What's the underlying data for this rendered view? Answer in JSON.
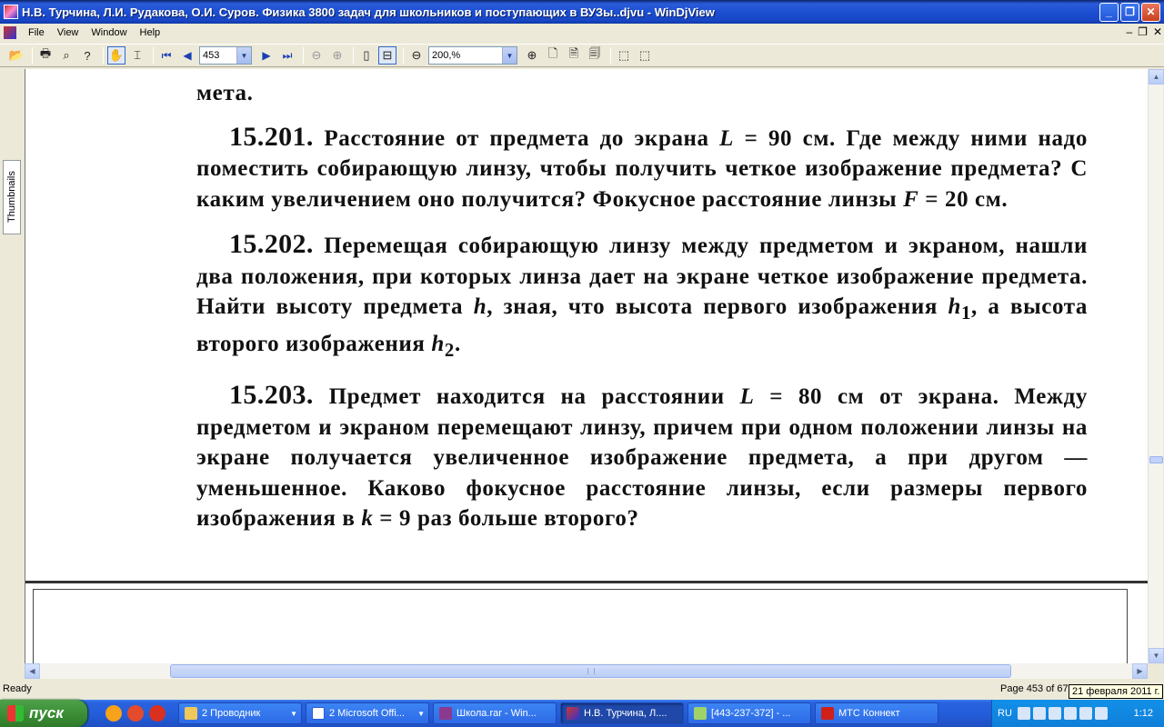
{
  "window": {
    "title": "Н.В. Турчина, Л.И. Рудакова, О.И. Суров. Физика 3800 задач для школьников и поступающих в ВУЗы..djvu - WinDjView",
    "controls": {
      "minimize": "_",
      "maximize": "❐",
      "close": "✕"
    }
  },
  "menu": {
    "items": [
      "File",
      "View",
      "Window",
      "Help"
    ]
  },
  "toolbar": {
    "page_value": "453",
    "zoom_value": "200,%"
  },
  "sidebar": {
    "tab_label": "Thumbnails"
  },
  "document": {
    "line_top": "мета.",
    "problems": [
      {
        "number": "15.201.",
        "parts": [
          "Расстояние от предмета до экрана ",
          "L",
          " = 90 см. Где между ними надо поместить собирающую линзу, чтобы получить четкое изображение предмета? С каким увеличением оно получится? Фокусное расстояние линзы ",
          "F",
          " = 20 см."
        ]
      },
      {
        "number": "15.202.",
        "parts": [
          "Перемещая собирающую линзу между предметом и экраном, нашли два положения, при которых линза дает на экране четкое изображение предмета. Найти высоту предмета ",
          "h",
          ", зная, что высота первого изображения ",
          "h",
          "1",
          ", а высота второго изображения ",
          "h",
          "2",
          "."
        ]
      },
      {
        "number": "15.203.",
        "parts": [
          "Предмет находится на расстоянии ",
          "L",
          " = 80 см от экрана. Между предметом и экраном перемещают линзу, причем при одном положении линзы на экране получается увеличенное изображение предмета, а при другом — уменьшенное. Каково фокусное расстояние линзы, если размеры первого изображения в ",
          "k",
          " = 9 раз больше второго?"
        ]
      }
    ]
  },
  "status": {
    "ready": "Ready",
    "page_info": "Page 453 of 67",
    "tooltip": "21 февраля 2011 г."
  },
  "taskbar": {
    "start_label": "пуск",
    "tasks": [
      {
        "label": "2 Проводник",
        "icon": "folder-icon",
        "dropdown": true
      },
      {
        "label": "2 Microsoft Offi...",
        "icon": "word-icon",
        "dropdown": true
      },
      {
        "label": "Школа.rar - Win...",
        "icon": "winrar-icon",
        "dropdown": false
      },
      {
        "label": "Н.В. Турчина, Л....",
        "icon": "windjview-icon",
        "dropdown": false,
        "active": true
      },
      {
        "label": "[443-237-372] - ...",
        "icon": "chat-icon",
        "dropdown": false
      },
      {
        "label": "МТС Коннект",
        "icon": "mts-icon",
        "dropdown": false
      }
    ],
    "tray": {
      "lang": "RU",
      "clock": "1:12"
    }
  }
}
